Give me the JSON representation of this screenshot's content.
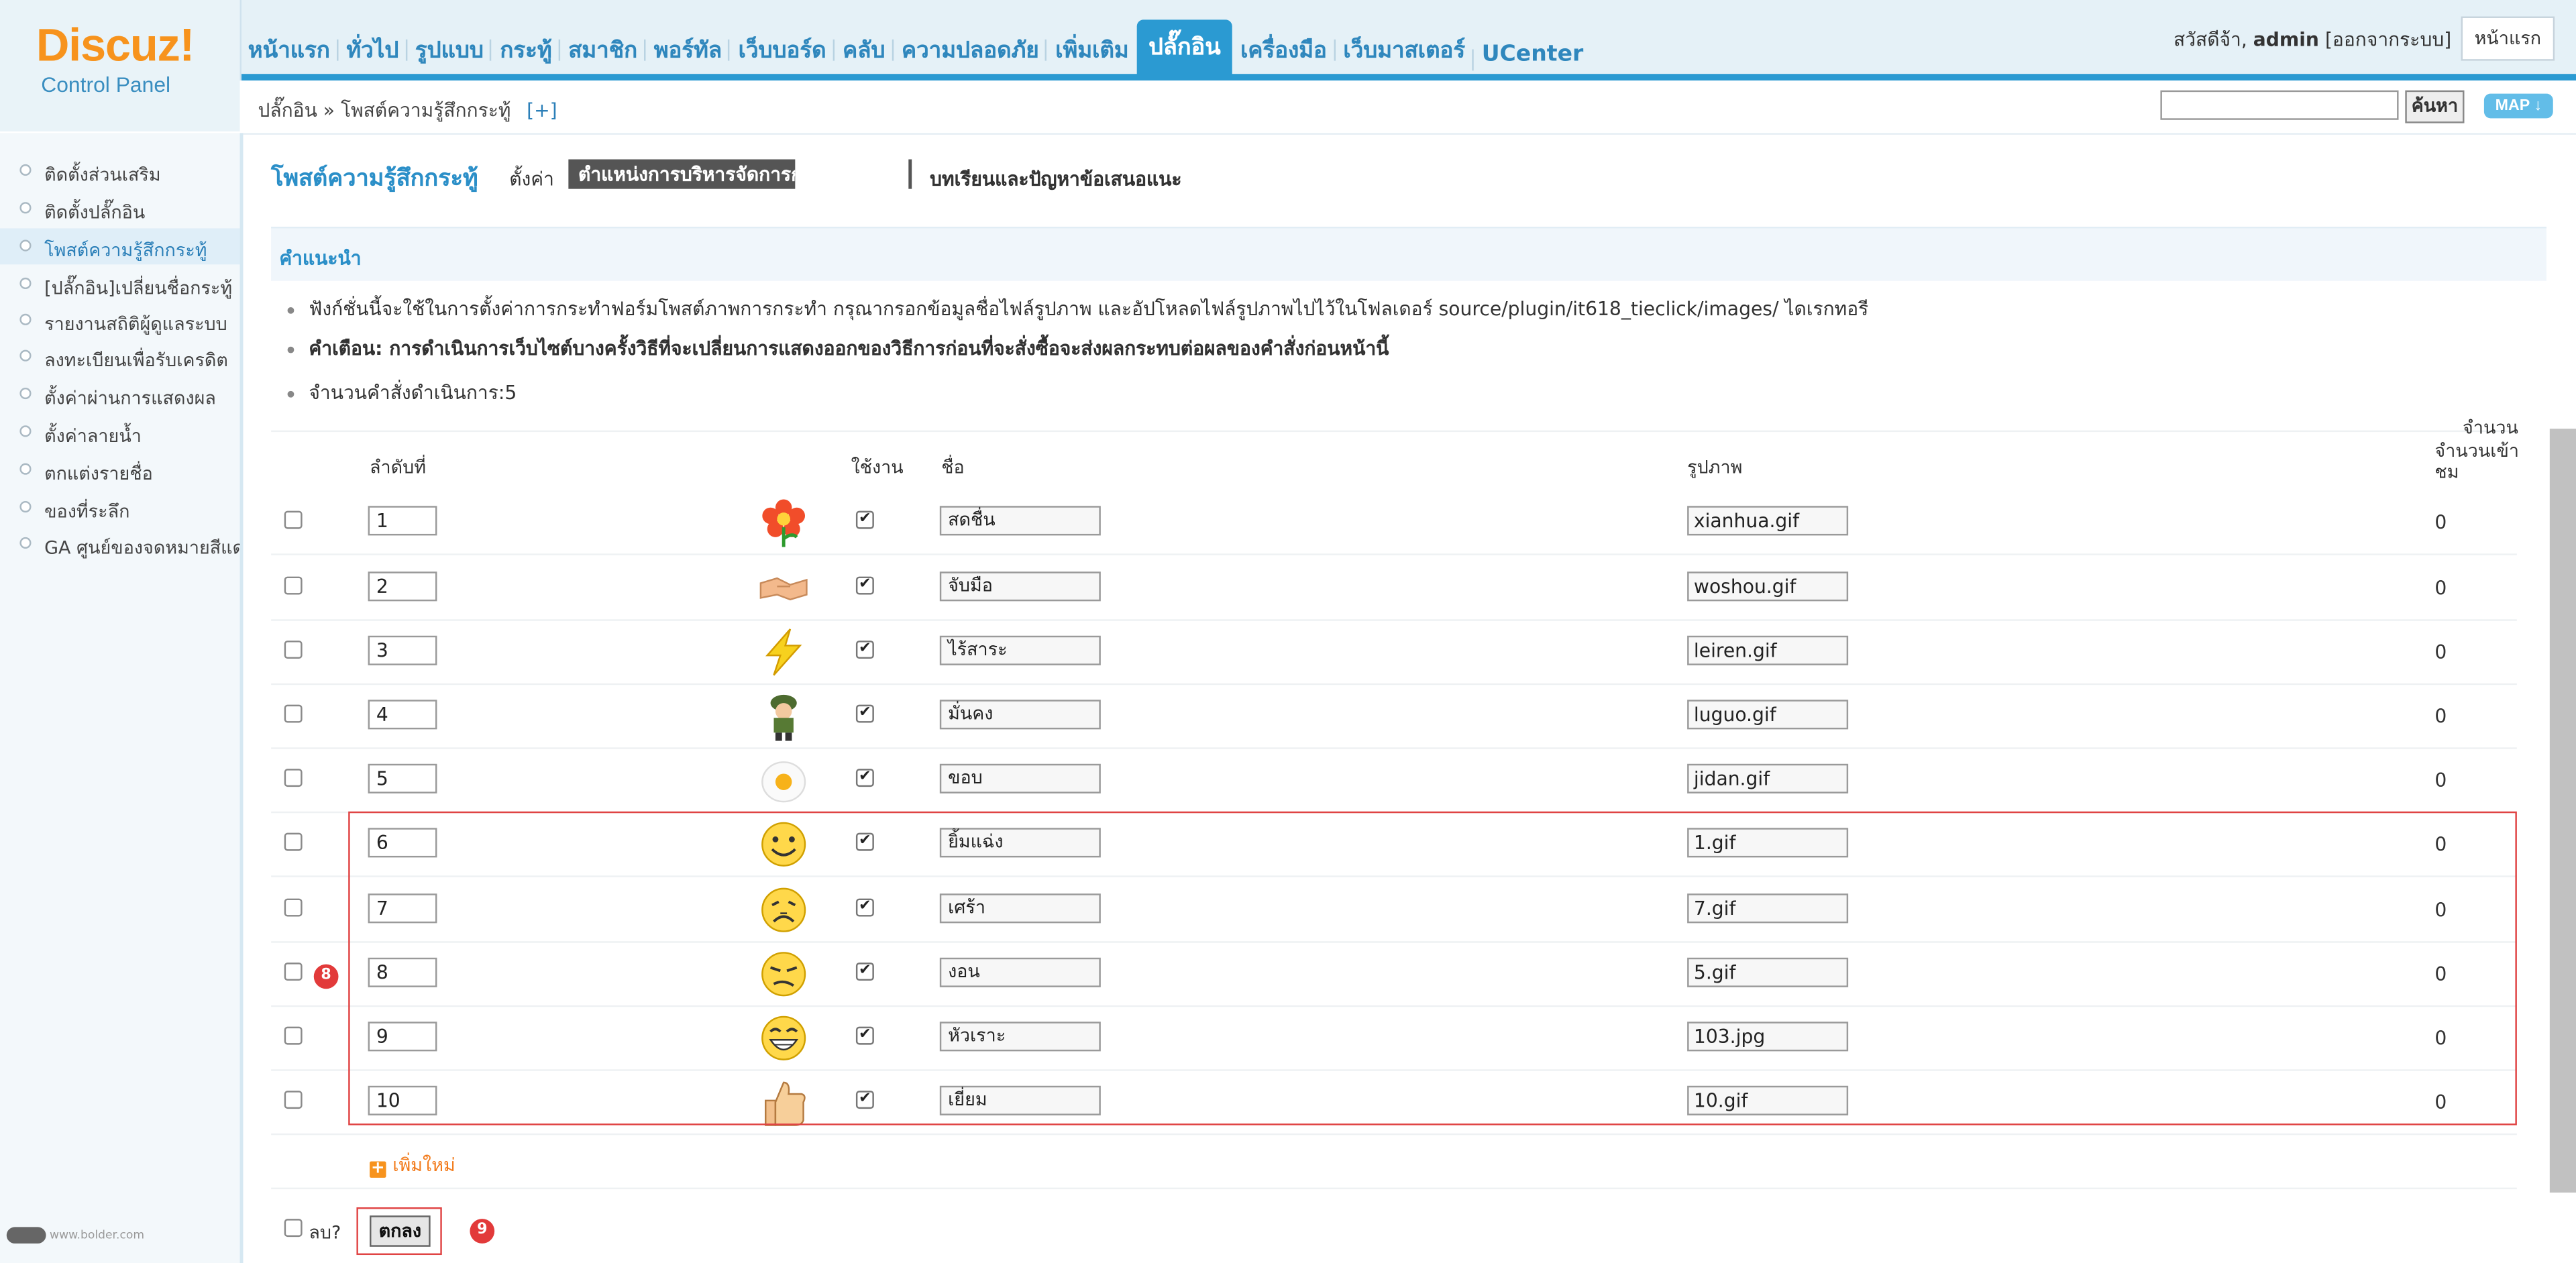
{
  "logo": {
    "main": "Discuz!",
    "sub": "Control Panel"
  },
  "nav": [
    "หน้าแรก",
    "ทั่วไป",
    "รูปแบบ",
    "กระทู้",
    "สมาชิก",
    "พอร์ทัล",
    "เว็บบอร์ด",
    "คลับ",
    "ความปลอดภัย",
    "เพิ่มเติม",
    "ปลั๊กอิน",
    "เครื่องมือ",
    "เว็บมาสเตอร์",
    "UCenter"
  ],
  "nav_active_index": 10,
  "user": {
    "greeting": "สวัสดีจ้า,",
    "name": "admin",
    "logout": "[ออกจากระบบ]",
    "home_button": "หน้าแรก"
  },
  "breadcrumb": {
    "text": "ปลั๊กอิน » โพสต์ความรู้สึกกระทู้",
    "plus": "[+]"
  },
  "search": {
    "button": "ค้นหา",
    "map": "MAP"
  },
  "sidebar": [
    "ติดตั้งส่วนเสริม",
    "ติดตั้งปลั๊กอิน",
    "โพสต์ความรู้สึกกระทู้",
    "[ปลั๊กอิน]เปลี่ยนชื่อกระทู้",
    "รายงานสถิติผู้ดูแลระบบ",
    "ลงทะเบียนเพื่อรับเครดิต",
    "ตั้งค่าผ่านการแสดงผล",
    "ตั้งค่าลายน้ำ",
    "ตกแต่งรายชื่อ",
    "ของที่ระลึก",
    "GA ศูนย์ของจดหมายสีแดง"
  ],
  "sidebar_active_index": 2,
  "page": {
    "title": "โพสต์ความรู้สึกกระทู้",
    "tab_settings": "ตั้งค่า",
    "tab_active": "ตำแหน่งการบริหารจัดการก",
    "tab_tutorial": "บทเรียนและปัญหาข้อเสนอแนะ"
  },
  "tips": {
    "title": "คำแนะนำ",
    "line1": "ฟังก์ชั่นนี้จะใช้ในการตั้งค่าการกระทำฟอร์มโพสต์ภาพการกระทำ กรุณากรอกข้อมูลชื่อไฟล์รูปภาพ และอัปโหลดไฟล์รูปภาพไปไว้ในโฟลเดอร์ source/plugin/it618_tieclick/images/ ไดเรกทอรี",
    "line2_bold": "คำเตือน: การดำเนินการเว็บไซต์บางครั้งวิธีที่จะเปลี่ยนการแสดงออกของวิธีการก่อนที่จะสั่งซื้อจะส่งผลกระทบต่อผลของคำสั่งก่อนหน้านี้",
    "line3": "จำนวนคำสั่งดำเนินการ:5"
  },
  "table": {
    "headers": {
      "order": "ลำดับที่",
      "enabled": "ใช้งาน",
      "name": "ชื่อ",
      "image": "รูปภาพ",
      "count": "จำนวน",
      "views": "จำนวนเข้าชม"
    },
    "rows": [
      {
        "order": "1",
        "icon": "flower",
        "name": "สดชื่น",
        "image": "xianhua.gif",
        "views": "0",
        "checked": true
      },
      {
        "order": "2",
        "icon": "handshake",
        "name": "จับมือ",
        "image": "woshou.gif",
        "views": "0",
        "checked": true
      },
      {
        "order": "3",
        "icon": "lightning",
        "name": "ไร้สาระ",
        "image": "leiren.gif",
        "views": "0",
        "checked": true
      },
      {
        "order": "4",
        "icon": "soldier",
        "name": "มั่นคง",
        "image": "luguo.gif",
        "views": "0",
        "checked": true
      },
      {
        "order": "5",
        "icon": "egg",
        "name": "ขอบ",
        "image": "jidan.gif",
        "views": "0",
        "checked": true
      },
      {
        "order": "6",
        "icon": "smile",
        "name": "ยิ้มแฉ่ง",
        "image": "1.gif",
        "views": "0",
        "checked": true
      },
      {
        "order": "7",
        "icon": "sad",
        "name": "เศร้า",
        "image": "7.gif",
        "views": "0",
        "checked": true
      },
      {
        "order": "8",
        "icon": "angry",
        "name": "งอน",
        "image": "5.gif",
        "views": "0",
        "checked": true
      },
      {
        "order": "9",
        "icon": "laugh",
        "name": "หัวเราะ",
        "image": "103.jpg",
        "views": "0",
        "checked": true
      },
      {
        "order": "10",
        "icon": "thumbs-up",
        "name": "เยี่ยม",
        "image": "10.gif",
        "views": "0",
        "checked": true
      }
    ]
  },
  "add_new": "เพิ่มใหม่",
  "delete_label": "ลบ?",
  "submit": "ตกลง",
  "annotations": {
    "rows_badge": "8",
    "submit_badge": "9"
  },
  "footer": "www.bolder.com"
}
